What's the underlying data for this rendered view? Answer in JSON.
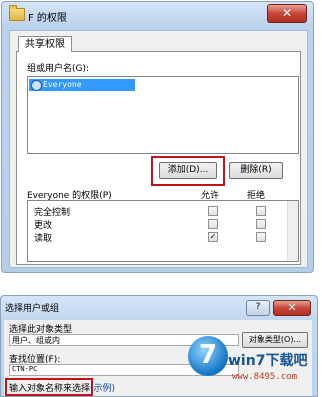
{
  "dialog": {
    "title": "F 的权限",
    "close_glyph": "✕",
    "tab_label": "共享权限",
    "group_label": "组或用户名(G):",
    "users": [
      {
        "name": "Everyone",
        "icon": "user-group-icon"
      }
    ],
    "add_button": "添加(D)...",
    "remove_button": "删除(R)",
    "permissions_header": "Everyone 的权限(P)",
    "allow_header": "允许",
    "deny_header": "拒绝",
    "permissions": [
      {
        "name": "完全控制",
        "allow": false,
        "deny": false
      },
      {
        "name": "更改",
        "allow": false,
        "deny": false
      },
      {
        "name": "读取",
        "allow": true,
        "deny": false
      }
    ],
    "check_glyph": "✓",
    "highlight_color": "#c0141b"
  },
  "select_dialog": {
    "title": "选择用户或组",
    "help_glyph": "?",
    "close_glyph": "✕",
    "object_type_label": "选择此对象类型",
    "object_type_value": "用户、组或内",
    "object_type_button": "对象类型(O)...",
    "location_label": "查找位置(F):",
    "location_value": "CTN-PC",
    "input_label": "输入对象名称来选择",
    "input_link": "(示例)"
  },
  "watermark": {
    "logo_glyph": "7",
    "brand": "win7下载吧",
    "url": "www.8495.com"
  }
}
